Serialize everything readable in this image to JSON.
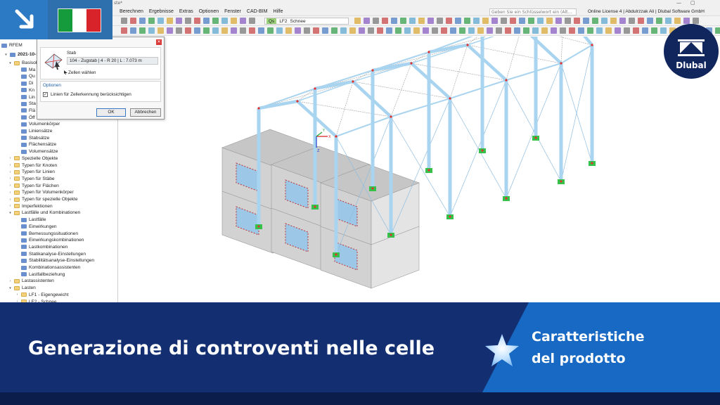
{
  "window": {
    "title_fragment": "ste*",
    "controls": [
      "—",
      "▢"
    ]
  },
  "menu": {
    "items": [
      "Berechnen",
      "Ergebnisse",
      "Extras",
      "Optionen",
      "Fenster",
      "CAD-BIM",
      "Hilfe"
    ],
    "search_placeholder": "Geben Sie ein Schlüsselwort ein (Alt...",
    "license": "Online License 4 | Abdulrzzak Ali | Dlubal Software GmbH"
  },
  "toolbar": {
    "loadcase_badge": "Qs",
    "loadcase_id": "LF2",
    "loadcase_name": "Schnee"
  },
  "navigator": {
    "root": "RFEM",
    "model": "2021-10-1...",
    "items": [
      {
        "label": "Basisobjekte",
        "depth": 1,
        "type": "folder",
        "open": true
      },
      {
        "label": "Ma",
        "depth": 2,
        "type": "item"
      },
      {
        "label": "Qu",
        "depth": 2,
        "type": "item"
      },
      {
        "label": "Di",
        "depth": 2,
        "type": "item"
      },
      {
        "label": "Kn",
        "depth": 2,
        "type": "item"
      },
      {
        "label": "Lin",
        "depth": 2,
        "type": "item"
      },
      {
        "label": "Sta",
        "depth": 2,
        "type": "item"
      },
      {
        "label": "Flä",
        "depth": 2,
        "type": "item"
      },
      {
        "label": "Öff",
        "depth": 2,
        "type": "item"
      },
      {
        "label": "Volumenkörper",
        "depth": 2,
        "type": "item"
      },
      {
        "label": "Liniensätze",
        "depth": 2,
        "type": "item"
      },
      {
        "label": "Stabsätze",
        "depth": 2,
        "type": "item"
      },
      {
        "label": "Flächensätze",
        "depth": 2,
        "type": "item"
      },
      {
        "label": "Volumensätze",
        "depth": 2,
        "type": "item"
      },
      {
        "label": "Spezielle Objekte",
        "depth": 1,
        "type": "folder"
      },
      {
        "label": "Typen für Knoten",
        "depth": 1,
        "type": "folder"
      },
      {
        "label": "Typen für Linien",
        "depth": 1,
        "type": "folder"
      },
      {
        "label": "Typen für Stäbe",
        "depth": 1,
        "type": "folder"
      },
      {
        "label": "Typen für Flächen",
        "depth": 1,
        "type": "folder"
      },
      {
        "label": "Typen für Volumenkörper",
        "depth": 1,
        "type": "folder"
      },
      {
        "label": "Typen für spezielle Objekte",
        "depth": 1,
        "type": "folder"
      },
      {
        "label": "Imperfektionen",
        "depth": 1,
        "type": "folder"
      },
      {
        "label": "Lastfälle und Kombinationen",
        "depth": 1,
        "type": "folder",
        "open": true
      },
      {
        "label": "Lastfälle",
        "depth": 2,
        "type": "item"
      },
      {
        "label": "Einwirkungen",
        "depth": 2,
        "type": "item"
      },
      {
        "label": "Bemessungssituationen",
        "depth": 2,
        "type": "item"
      },
      {
        "label": "Einwirkungskombinationen",
        "depth": 2,
        "type": "item"
      },
      {
        "label": "Lastkombinationen",
        "depth": 2,
        "type": "item"
      },
      {
        "label": "Statikanalyse-Einstellungen",
        "depth": 2,
        "type": "item"
      },
      {
        "label": "Stabilitätsanalyse-Einstellungen",
        "depth": 2,
        "type": "item"
      },
      {
        "label": "Kombinationsassistenten",
        "depth": 2,
        "type": "item"
      },
      {
        "label": "Lastfallbeziehung",
        "depth": 2,
        "type": "item"
      },
      {
        "label": "Lastassistenten",
        "depth": 1,
        "type": "folder"
      },
      {
        "label": "Lasten",
        "depth": 1,
        "type": "folder",
        "open": true
      },
      {
        "label": "LF1 - Eigengewicht",
        "depth": 2,
        "type": "folder"
      },
      {
        "label": "LF2 - Schnee",
        "depth": 2,
        "type": "folder"
      }
    ]
  },
  "dialog": {
    "member_label": "Stab",
    "member_value": "104 - Zugstab | 4 - R 20 | L : 7.073 m",
    "select_cells": "Zellen wählen",
    "options_title": "Optionen",
    "checkbox_label": "Linien für Zellerkennung berücksichtigen",
    "checkbox_checked": true,
    "ok": "OK",
    "cancel": "Abbrechen"
  },
  "axes": {
    "x": "X",
    "y": "Y",
    "z": "Z"
  },
  "badge": {
    "flag_colors": [
      "#159b3b",
      "#ffffff",
      "#d8232a"
    ]
  },
  "logo": {
    "text": "Dlubal"
  },
  "banner": {
    "title": "Generazione di controventi nelle celle",
    "feature_line1": "Caratteristiche",
    "feature_line2": "del prodotto"
  },
  "colors": {
    "banner": "#132f72",
    "banner_panel": "#1769c4",
    "member": "#a9d4f0",
    "support": "#35c24a",
    "node": "#e2322f"
  }
}
